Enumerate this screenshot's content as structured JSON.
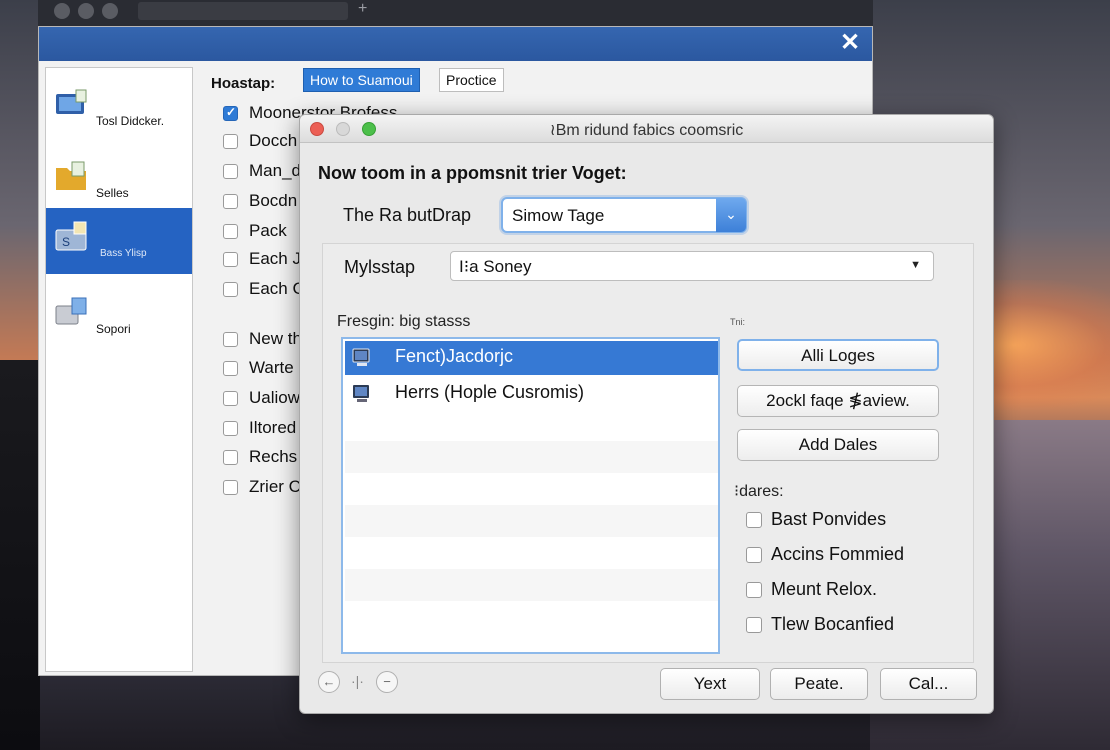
{
  "back_window": {
    "close_glyph": "✕",
    "sidebar": [
      {
        "label": "Tosl Didcker.",
        "icon": "computer-icon"
      },
      {
        "label": "Selles",
        "icon": "folder-icon"
      },
      {
        "label": "Bass Ylisp",
        "icon": "drive-icon",
        "selected": true
      },
      {
        "label": "Sopori",
        "icon": "network-icon"
      }
    ],
    "section_label": "Hoastap:",
    "tabs": [
      {
        "label": "How to Suamoui",
        "active": true
      },
      {
        "label": "Proctice",
        "active": false
      }
    ],
    "checkbox_items": [
      {
        "label": "Moonerstor Brofess",
        "checked": true
      },
      {
        "label": "Docch",
        "checked": false
      },
      {
        "label": "Man_d",
        "checked": false
      },
      {
        "label": "Bocdn",
        "checked": false
      },
      {
        "label": "Pack",
        "checked": false
      },
      {
        "label": "Each J",
        "checked": false
      },
      {
        "label": "Each C",
        "checked": false
      },
      {
        "label": "New th",
        "checked": false
      },
      {
        "label": "Warte",
        "checked": false
      },
      {
        "label": "Ualiow",
        "checked": false
      },
      {
        "label": "Iltored",
        "checked": false
      },
      {
        "label": "Rechs",
        "checked": false
      },
      {
        "label": "Zrier C",
        "checked": false
      }
    ]
  },
  "dialog": {
    "title": "≀Bm ridund fabics coomsric",
    "heading": "Now toom in a ppomsnit trier Voget:",
    "combo": {
      "label": "The Ra butDrap",
      "value": "Simow Tage",
      "arrow": "⌄"
    },
    "select": {
      "label": "Mylsstap",
      "value": "I⁝a Soney",
      "arrow": "▼"
    },
    "list_label": "Fresgin: big stasss",
    "list_items": [
      {
        "label": "Fenct)Jacdorjc",
        "selected": true
      },
      {
        "label": "Herrs (Hople Cusromis)",
        "selected": false
      }
    ],
    "mini_label": "Tni:",
    "buttons": [
      "Alli Loges",
      "2ockl faqe ≸aview.",
      "Add Dales"
    ],
    "options_label": "⁝dares:",
    "options": [
      "Bast Ponvides",
      "Accins Fommied",
      "Meunt Relox.",
      "Tlew Bocanfied"
    ],
    "nav": {
      "back": "←",
      "separator": "·|·",
      "remove": "−"
    },
    "footer_buttons": [
      "Yext",
      "Peate.",
      "Cal..."
    ]
  },
  "colors": {
    "accent": "#2f7bd6",
    "title_bar": "#3566b0",
    "selection": "#3679d4"
  }
}
